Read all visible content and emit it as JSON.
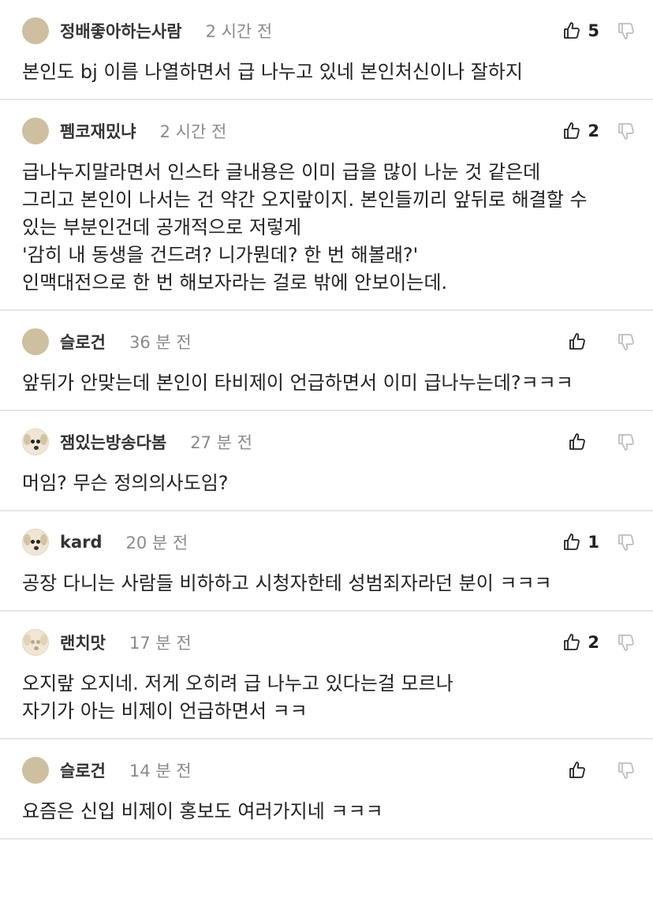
{
  "comments": [
    {
      "avatar": "default",
      "username": "정배좋아하는사람",
      "time": "2 시간 전",
      "likes": "5",
      "lines": [
        "본인도 bj 이름 나열하면서 급 나누고 있네 본인처신이나 잘하지"
      ]
    },
    {
      "avatar": "default",
      "username": "펨코재밌냐",
      "time": "2 시간 전",
      "likes": "2",
      "lines": [
        "급나누지말라면서 인스타 글내용은 이미 급을 많이 나눈 것 같은데",
        "그리고 본인이 나서는 건 약간 오지랖이지. 본인들끼리 앞뒤로 해결할 수",
        "있는 부분인건데 공개적으로 저렇게",
        "'감히 내 동생을 건드려? 니가뭔데? 한 번 해볼래?'",
        "인맥대전으로 한 번 해보자라는 걸로 밖에 안보이는데."
      ]
    },
    {
      "avatar": "default",
      "username": "슬로건",
      "time": "36 분 전",
      "likes": "",
      "lines": [
        "앞뒤가 안맞는데 본인이 타비제이 언급하면서 이미 급나누는데?ㅋㅋㅋ"
      ]
    },
    {
      "avatar": "dog",
      "username": "잼있는방송다봄",
      "time": "27 분 전",
      "likes": "",
      "lines": [
        "머임? 무슨 정의의사도임?"
      ]
    },
    {
      "avatar": "dog",
      "username": "kard",
      "time": "20 분 전",
      "likes": "1",
      "lines": [
        "공장 다니는 사람들 비하하고 시청자한테 성범죄자라던 분이 ㅋㅋㅋ"
      ]
    },
    {
      "avatar": "dog-faded",
      "username": "랜치맛",
      "time": "17 분 전",
      "likes": "2",
      "lines": [
        "오지랖 오지네. 저게 오히려 급 나누고 있다는걸 모르나",
        "자기가 아는 비제이 언급하면서 ㅋㅋ"
      ]
    },
    {
      "avatar": "default",
      "username": "슬로건",
      "time": "14 분 전",
      "likes": "",
      "lines": [
        "요즘은 신입 비제이 홍보도 여러가지네 ㅋㅋㅋ"
      ]
    }
  ],
  "icons": {
    "like": "thumbs-up-icon",
    "dislike": "thumbs-down-icon"
  }
}
